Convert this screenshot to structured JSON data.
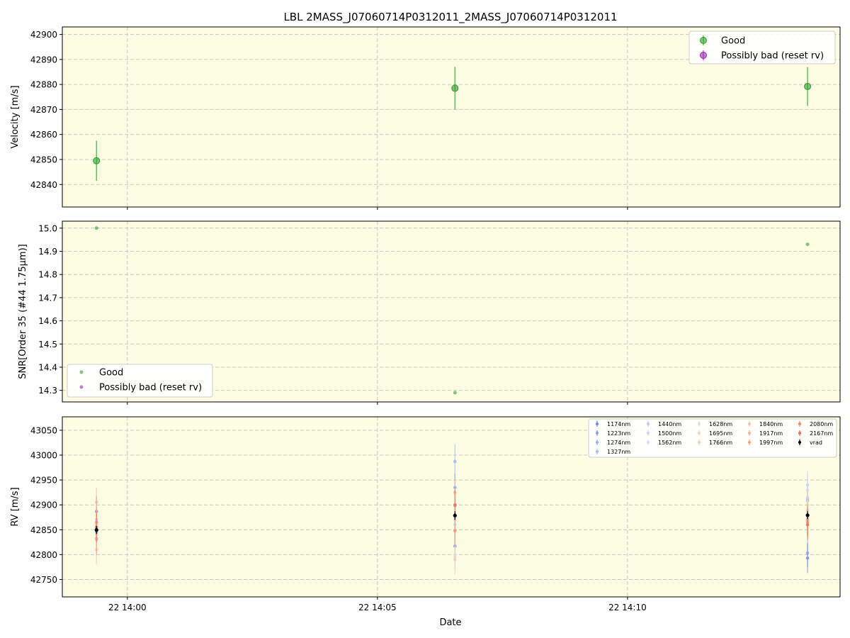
{
  "title": "LBL 2MASS_J07060714P0312011_2MASS_J07060714P0312011",
  "xlabel": "Date",
  "x_tick_labels": [
    "22 14:00",
    "22 14:05",
    "22 14:10"
  ],
  "colors": {
    "panel_bg": "#fdfde3",
    "good": "#2ca02c",
    "bad": "#9c27b0",
    "vrad": "#000000",
    "grid": "#c8c8c8"
  },
  "chart_data": [
    {
      "type": "scatter",
      "panel": "velocity",
      "ylabel": "Velocity [m/s]",
      "ylim": [
        42831,
        42903
      ],
      "y_ticks": [
        42840,
        42850,
        42860,
        42870,
        42880,
        42890,
        42900
      ],
      "legend": {
        "placement": "top-right",
        "entries": [
          "Good",
          "Possibly bad (reset rv)"
        ]
      },
      "series": [
        {
          "name": "Good",
          "points": [
            {
              "t": "13:59:23",
              "y": 42849.5,
              "err": 8.0
            },
            {
              "t": "14:06:33",
              "y": 42878.5,
              "err": 8.5
            },
            {
              "t": "14:13:36",
              "y": 42879.2,
              "err": 7.8
            }
          ]
        },
        {
          "name": "Possibly bad (reset rv)",
          "points": []
        }
      ],
      "grid": true
    },
    {
      "type": "scatter",
      "panel": "snr",
      "ylabel": "SNR[Order 35 (#44 1.75μm)]",
      "ylim": [
        14.25,
        15.03
      ],
      "y_ticks": [
        14.3,
        14.4,
        14.5,
        14.6,
        14.7,
        14.8,
        14.9,
        15.0
      ],
      "legend": {
        "placement": "bottom-left",
        "entries": [
          "Good",
          "Possibly bad (reset rv)"
        ]
      },
      "series": [
        {
          "name": "Good",
          "points": [
            {
              "t": "13:59:23",
              "y": 15.0
            },
            {
              "t": "14:06:33",
              "y": 14.29
            },
            {
              "t": "14:13:36",
              "y": 14.93
            }
          ]
        },
        {
          "name": "Possibly bad (reset rv)",
          "points": []
        }
      ],
      "grid": true
    },
    {
      "type": "scatter",
      "panel": "rv",
      "ylabel": "RV [m/s]",
      "ylim": [
        42715,
        43077
      ],
      "y_ticks": [
        42750,
        42800,
        42850,
        42900,
        42950,
        43000,
        43050
      ],
      "legend": {
        "placement": "top-right",
        "entries": [
          "1174nm",
          "1223nm",
          "1274nm",
          "1327nm",
          "1440nm",
          "1500nm",
          "1562nm",
          "1628nm",
          "1695nm",
          "1766nm",
          "1840nm",
          "1917nm",
          "1997nm",
          "2080nm",
          "2167nm",
          "vrad"
        ]
      },
      "times": [
        "13:59:23",
        "14:06:33",
        "14:13:36"
      ],
      "series": [
        {
          "name": "1174nm",
          "color": "#6a8bef",
          "values": [
            42887,
            42817,
            42793
          ],
          "err": [
            30,
            28,
            30
          ]
        },
        {
          "name": "1223nm",
          "color": "#7c9df5",
          "values": [
            42845,
            42935,
            42803
          ],
          "err": [
            30,
            28,
            28
          ]
        },
        {
          "name": "1274nm",
          "color": "#8fb0fa",
          "values": [
            42833,
            42987,
            42912
          ],
          "err": [
            30,
            35,
            30
          ]
        },
        {
          "name": "1327nm",
          "color": "#a3c0fd",
          "values": [
            42870,
            42900,
            42908
          ],
          "err": [
            30,
            30,
            30
          ]
        },
        {
          "name": "1440nm",
          "color": "#b7cefe",
          "values": [
            42860,
            42880,
            42940
          ],
          "err": [
            30,
            30,
            28
          ]
        },
        {
          "name": "1500nm",
          "color": "#c6d6fb",
          "values": [
            42850,
            42860,
            42915
          ],
          "err": [
            30,
            30,
            30
          ]
        },
        {
          "name": "1562nm",
          "color": "#d4dcf4",
          "values": [
            42865,
            42870,
            42930
          ],
          "err": [
            30,
            30,
            30
          ]
        },
        {
          "name": "1628nm",
          "color": "#dedede",
          "values": [
            42855,
            42800,
            42890
          ],
          "err": [
            30,
            30,
            30
          ]
        },
        {
          "name": "1695nm",
          "color": "#e8d8cc",
          "values": [
            42860,
            42795,
            42880
          ],
          "err": [
            30,
            30,
            30
          ]
        },
        {
          "name": "1766nm",
          "color": "#eccdbb",
          "values": [
            42840,
            42790,
            42870
          ],
          "err": [
            30,
            30,
            30
          ]
        },
        {
          "name": "1840nm",
          "color": "#f4c3a8",
          "values": [
            42810,
            42880,
            42900
          ],
          "err": [
            30,
            30,
            30
          ]
        },
        {
          "name": "1917nm",
          "color": "#f5b497",
          "values": [
            42905,
            42925,
            42860
          ],
          "err": [
            30,
            30,
            30
          ]
        },
        {
          "name": "1997nm",
          "color": "#f2a183",
          "values": [
            42830,
            42898,
            42870
          ],
          "err": [
            30,
            30,
            30
          ]
        },
        {
          "name": "2080nm",
          "color": "#ec8b6e",
          "values": [
            42865,
            42848,
            42865
          ],
          "err": [
            30,
            30,
            30
          ]
        },
        {
          "name": "2167nm",
          "color": "#e2735c",
          "values": [
            42855,
            42900,
            42860
          ],
          "err": [
            30,
            30,
            30
          ]
        },
        {
          "name": "vrad",
          "color": "#000000",
          "values": [
            42849.5,
            42878.5,
            42879.2
          ],
          "err": [
            8,
            8.5,
            7.8
          ]
        }
      ],
      "grid": true
    }
  ]
}
